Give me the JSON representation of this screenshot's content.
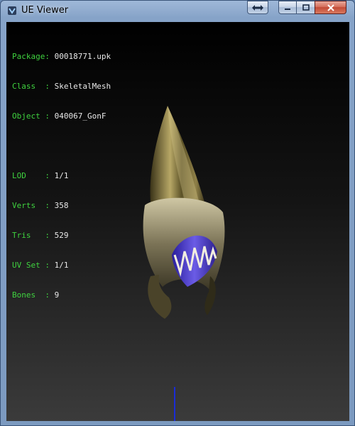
{
  "window": {
    "title": "UE Viewer",
    "icons": {
      "app": "ue-viewer-app-icon",
      "swap": "swap-arrows-icon",
      "minimize": "minimize-icon",
      "maximize": "maximize-icon",
      "close": "close-icon"
    }
  },
  "info": {
    "package": {
      "label": "Package: ",
      "value": "00018771.upk"
    },
    "class": {
      "label": "Class  : ",
      "value": "SkeletalMesh"
    },
    "object": {
      "label": "Object : ",
      "value": "040067_GonF"
    },
    "lod": {
      "label": "LOD    : ",
      "value": "1/1"
    },
    "verts": {
      "label": "Verts  : ",
      "value": "358"
    },
    "tris": {
      "label": "Tris   : ",
      "value": "529"
    },
    "uvset": {
      "label": "UV Set : ",
      "value": "1/1"
    },
    "bones": {
      "label": "Bones  : ",
      "value": "9"
    }
  },
  "colors": {
    "label": "#3fd23f",
    "value": "#e8e8e8",
    "axis": "#1a2cd6"
  }
}
